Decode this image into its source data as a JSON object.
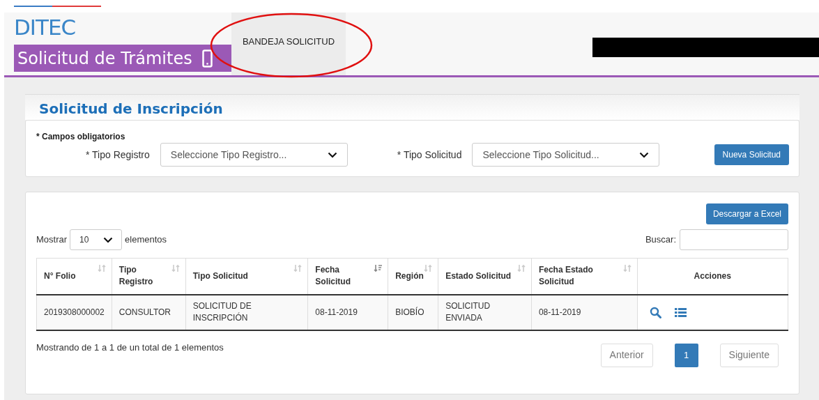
{
  "header": {
    "brand": "DITEC",
    "app_title": "Solicitud de Trámites",
    "nav": [
      {
        "label": "BANDEJA SOLICITUD",
        "selected": true
      }
    ]
  },
  "page_title": "Solicitud de Inscripción",
  "filters": {
    "required_note": "* Campos obligatorios",
    "fields": [
      {
        "label": "* Tipo Registro",
        "placeholder": "Seleccione Tipo Registro..."
      },
      {
        "label": "* Tipo Solicitud",
        "placeholder": "Seleccione Tipo Solicitud..."
      }
    ],
    "button": "Nueva Solicitud"
  },
  "table_panel": {
    "export_button": "Descargar a Excel",
    "length": {
      "prefix": "Mostrar",
      "value": "10",
      "suffix": "elementos"
    },
    "search_label": "Buscar:",
    "columns": [
      {
        "label": "N° Folio",
        "kind": "sortable"
      },
      {
        "label": "Tipo Registro",
        "kind": "sortable"
      },
      {
        "label": "Tipo Solicitud",
        "kind": "sortable"
      },
      {
        "label": "Fecha Solicitud",
        "kind": "descending"
      },
      {
        "label": "Región",
        "kind": "sortable"
      },
      {
        "label": "Estado Solicitud",
        "kind": "sortable"
      },
      {
        "label": "Fecha Estado Solicitud",
        "kind": "sortable"
      },
      {
        "label": "Acciones",
        "kind": "plain"
      }
    ],
    "rows": [
      {
        "cells": [
          "2019308000002",
          "CONSULTOR",
          "SOLICITUD DE INSCRIPCIÓN",
          "08-11-2019",
          "BIOBÍO",
          "SOLICITUD ENVIADA",
          "08-11-2019"
        ],
        "actions": [
          {
            "kind": "view"
          },
          {
            "kind": "list"
          }
        ]
      }
    ],
    "info": "Mostrando de 1 a 1 de un total de 1 elementos",
    "pagination": {
      "previous": {
        "label": "Anterior",
        "disabled": true
      },
      "pages": [
        {
          "label": "1",
          "selected": true
        }
      ],
      "next": {
        "label": "Siguiente",
        "disabled": true
      }
    }
  }
}
